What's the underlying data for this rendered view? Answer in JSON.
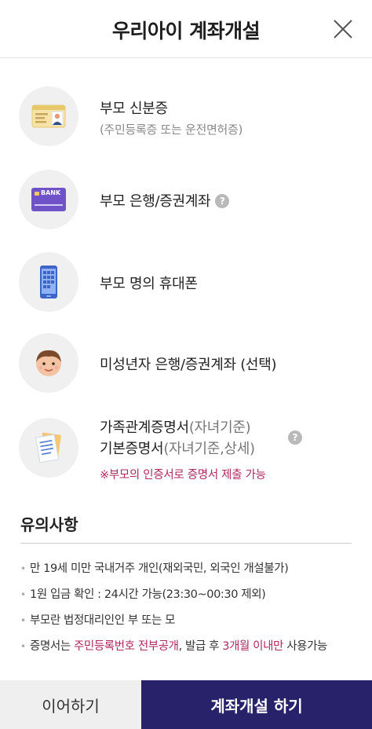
{
  "header": {
    "title": "우리아이 계좌개설",
    "close_icon": "close-icon"
  },
  "requirements": {
    "id_card": {
      "icon": "id-card-icon",
      "label": "부모 신분증",
      "sub": "(주민등록증 또는 운전면허증)"
    },
    "bank": {
      "icon": "bank-card-icon",
      "label": "부모 은행/증권계좌",
      "card_text": "BANK",
      "help": "?"
    },
    "phone": {
      "icon": "smartphone-icon",
      "label": "부모 명의 휴대폰"
    },
    "minor": {
      "icon": "child-face-icon",
      "label": "미성년자 은행/증권계좌 (선택)"
    },
    "docs": {
      "icon": "document-icon",
      "line1_main": "가족관계증명서",
      "line1_paren": "(자녀기준)",
      "line2_main": "기본증명서",
      "line2_paren": "(자녀기준,상세)",
      "note": "※부모의 인증서로 증명서 제출 가능",
      "help": "?"
    }
  },
  "notice": {
    "title": "유의사항",
    "items": [
      "만 19세 미만 국내거주 개인(재외국민, 외국인 개설불가)",
      "1원 입금 확인 : 24시간 가능(23:30~00:30 제외)",
      "부모란 법정대리인인 부 또는 모"
    ],
    "last": {
      "part1": "증명서는 ",
      "highlight1": "주민등록번호 전부공개",
      "part2": ", 발급 후 ",
      "highlight2": "3개월 이내만",
      "part3": " 사용가능"
    }
  },
  "buttons": {
    "continue": "이어하기",
    "open": "계좌개설 하기"
  },
  "colors": {
    "primary": "#27226a",
    "accent_pink": "#b0295f",
    "bank_card": "#6f52c8",
    "circle_bg": "#f0f0f0"
  }
}
